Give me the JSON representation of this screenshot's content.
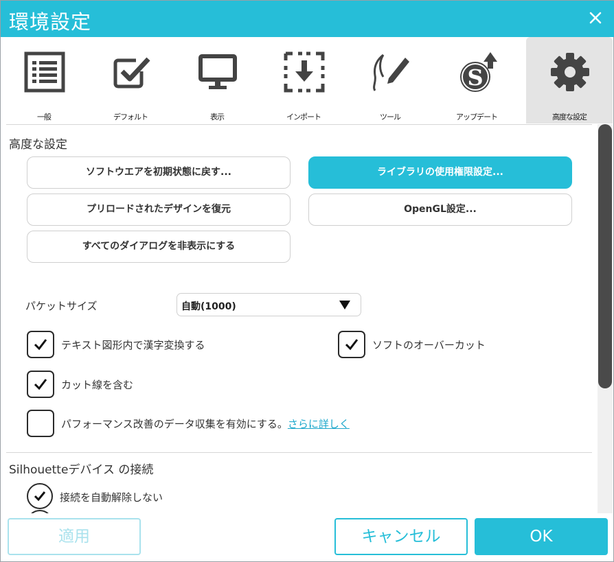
{
  "window": {
    "title": "環境設定"
  },
  "tabs": [
    {
      "label": "一般",
      "icon": "list-icon"
    },
    {
      "label": "デフォルト",
      "icon": "checkbox-icon"
    },
    {
      "label": "表示",
      "icon": "monitor-icon"
    },
    {
      "label": "インポート",
      "icon": "import-icon"
    },
    {
      "label": "ツール",
      "icon": "pen-tool-icon"
    },
    {
      "label": "アップデート",
      "icon": "update-icon"
    },
    {
      "label": "高度な設定",
      "icon": "gear-icon",
      "active": true
    }
  ],
  "advanced": {
    "title": "高度な設定",
    "buttons": {
      "reset": "ソフトウエアを初期状態に戻す...",
      "library_permissions": "ライブラリの使用権限設定...",
      "restore_designs": "プリロードされたデザインを復元",
      "opengl": "OpenGL設定...",
      "hide_dialogs": "すべてのダイアログを非表示にする"
    },
    "packet_size": {
      "label": "パケットサイズ",
      "value": "自動(1000)"
    },
    "checks": {
      "kanji_convert": {
        "label": "テキスト図形内で漢字変換する",
        "checked": true
      },
      "overcut": {
        "label": "ソフトのオーバーカット",
        "checked": true
      },
      "include_cut_lines": {
        "label": "カット線を含む",
        "checked": true
      },
      "performance": {
        "label": "パフォーマンス改善のデータ収集を有効にする。",
        "link": "さらに詳しく",
        "checked": false
      }
    }
  },
  "device_connection": {
    "title": "Silhouetteデバイス の接続",
    "options": [
      {
        "label": "接続を自動解除しない",
        "selected": true
      }
    ]
  },
  "footer": {
    "apply": "適用",
    "cancel": "キャンセル",
    "ok": "OK"
  },
  "colors": {
    "accent": "#26bed8",
    "accent_light": "#a9e2ed",
    "active_tab_bg": "#e4e4e4",
    "scroll_thumb": "#4a4a4a"
  }
}
